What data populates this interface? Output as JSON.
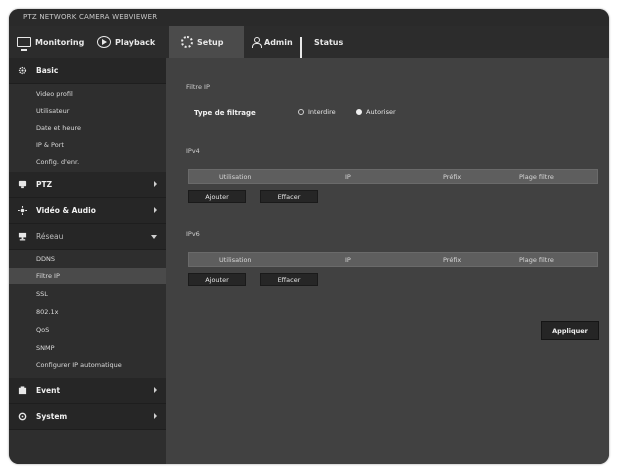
{
  "window": {
    "title": "PTZ NETWORK CAMERA WEBVIEWER"
  },
  "menu": {
    "monitoring": "Monitoring",
    "playback": "Playback",
    "setup": "Setup",
    "admin": "Admin",
    "status": "Status"
  },
  "sidebar": {
    "basic": {
      "label": "Basic",
      "icon": "gear-icon"
    },
    "basic_items": [
      "Video profil",
      "Utilisateur",
      "Date et heure",
      "IP & Port",
      "Config. d'enr."
    ],
    "ptz": {
      "label": "PTZ",
      "icon": "ptz-icon"
    },
    "video_audio": {
      "label": "Vidéo & Audio",
      "icon": "video-audio-icon"
    },
    "network": {
      "label": "Réseau",
      "icon": "network-icon"
    },
    "network_items": [
      "DDNS",
      "Filtre IP",
      "SSL",
      "802.1x",
      "QoS",
      "SNMP",
      "Configurer IP automatique"
    ],
    "event": {
      "label": "Event",
      "icon": "event-icon"
    },
    "system": {
      "label": "System",
      "icon": "system-icon"
    }
  },
  "content": {
    "filter_section_title": "Filtre IP",
    "filter_type_label": "Type de filtrage",
    "radio_deny": "Interdire",
    "radio_allow": "Autoriser",
    "radio_selected": "Autoriser",
    "ipv4_title": "IPv4",
    "ipv6_title": "IPv6",
    "table_headers": [
      "Utilisation",
      "IP",
      "Préfix",
      "Plage filtre"
    ],
    "add_button": "Ajouter",
    "delete_button": "Effacer",
    "apply_button": "Appliquer"
  },
  "colors": {
    "frame_bg": "#3a3a3a",
    "content_bg": "#414141",
    "sidebar_bg": "#2e2e2e",
    "active_tab": "#4b4b4b"
  }
}
